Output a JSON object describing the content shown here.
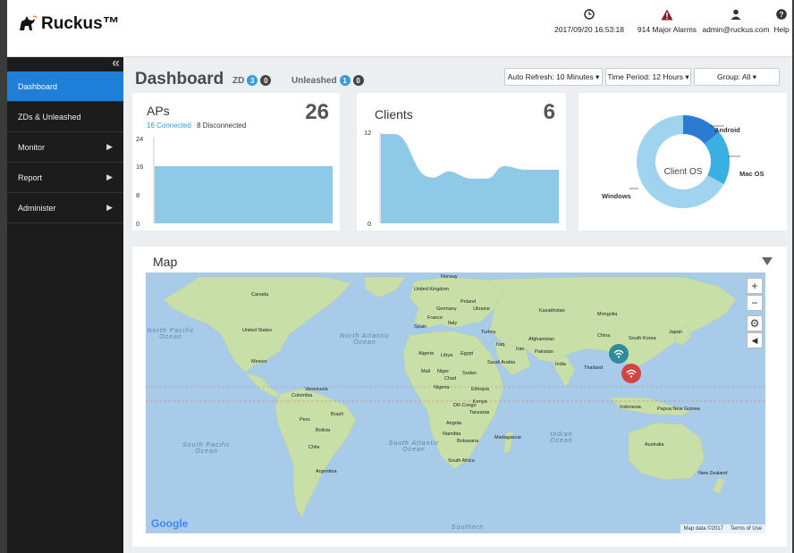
{
  "header": {
    "brand": "Ruckus™",
    "datetime": "2017/09/20 16:53:18",
    "alarms": "914 Major Alarms",
    "user": "admin@ruckus.com",
    "help": "Help",
    "icons": {
      "clock": "clock-icon",
      "alarm": "alarm-triangle-icon",
      "user": "user-icon",
      "help": "help-icon"
    },
    "alarm_color": "#8b1a2b"
  },
  "sidebar": {
    "collapse": "«",
    "items": [
      {
        "label": "Dashboard",
        "active": true
      },
      {
        "label": "ZDs & Unleashed"
      },
      {
        "label": "Monitor",
        "arrow": "▶"
      },
      {
        "label": "Report",
        "arrow": "▶"
      },
      {
        "label": "Administer",
        "arrow": "▶"
      }
    ],
    "active_color": "#1e7fd8"
  },
  "main": {
    "title": "Dashboard",
    "zd": {
      "label": "ZD",
      "connected": "3",
      "disconnected": "0"
    },
    "unleashed": {
      "label": "Unleashed",
      "connected": "1",
      "disconnected": "0"
    },
    "auto_refresh": "Auto Refresh: 10 Minutes ▾",
    "time_period": "Time Period: 12 Hours ▾",
    "group": "Group: All ▾"
  },
  "aps": {
    "title": "APs",
    "total": "26",
    "connected": "16 Connected",
    "disconnected": "8 Disconnected",
    "y_ticks": [
      "24",
      "16",
      "8",
      "0"
    ]
  },
  "clients": {
    "title": "Clients",
    "total": "6",
    "y_ticks": [
      "12",
      "0"
    ]
  },
  "client_os": {
    "center": "Client OS",
    "labels": {
      "android": "Android",
      "mac": "Mac OS",
      "windows": "Windows"
    }
  },
  "map": {
    "title": "Map",
    "google": "Google",
    "attribution": "Map data ©2017",
    "terms": "Terms of Use",
    "controls": {
      "zoom_in": "+",
      "zoom_out": "−",
      "settings": "⚙",
      "toggle": "◀"
    },
    "oceans": {
      "north_pacific": "North Pacific Ocean",
      "north_atlantic": "North Atlantic Ocean",
      "south_pacific": "South Pacific Ocean",
      "south_atlantic": "South Atlantic Ocean",
      "indian": "Indian Ocean",
      "southern": "Southern"
    },
    "countries": [
      "Canada",
      "United States",
      "Mexico",
      "Venezuela",
      "Colombia",
      "Peru",
      "Brazil",
      "Bolivia",
      "Chile",
      "Argentina",
      "Norway",
      "United Kingdom",
      "Poland",
      "Germany",
      "France",
      "Spain",
      "Italy",
      "Ukraine",
      "Kazakhstan",
      "Mongolia",
      "China",
      "South Korea",
      "Japan",
      "Turkey",
      "Iraq",
      "Iran",
      "Afghanistan",
      "Pakistan",
      "India",
      "Thailand",
      "Algeria",
      "Libya",
      "Egypt",
      "Saudi Arabia",
      "Mali",
      "Niger",
      "Chad",
      "Sudan",
      "Nigeria",
      "Ethiopia",
      "DR Congo",
      "Kenya",
      "Tanzania",
      "Angola",
      "Namibia",
      "Botswana",
      "Madagascar",
      "South Africa",
      "Indonesia",
      "Papua New Guinea",
      "Australia",
      "New Zealand"
    ]
  }
}
